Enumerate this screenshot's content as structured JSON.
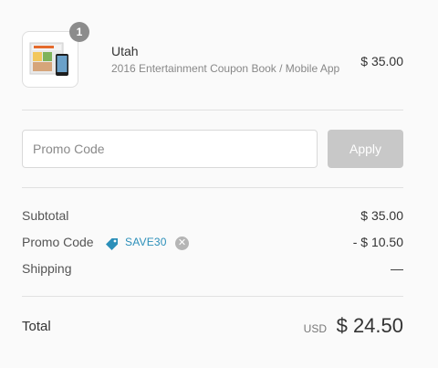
{
  "cart": {
    "item": {
      "quantity": "1",
      "name": "Utah",
      "variant": "2016 Entertainment Coupon Book / Mobile App",
      "price": "$ 35.00"
    }
  },
  "promo": {
    "placeholder": "Promo Code",
    "apply_label": "Apply"
  },
  "summary": {
    "subtotal_label": "Subtotal",
    "subtotal_value": "$ 35.00",
    "promo_label": "Promo Code",
    "promo_code": "SAVE30",
    "promo_value": "- $ 10.50",
    "shipping_label": "Shipping",
    "shipping_value": "—",
    "total_label": "Total",
    "currency": "USD",
    "total_value": "$ 24.50"
  },
  "colors": {
    "accent": "#2b8fb9",
    "button_disabled": "#c8c8c8",
    "badge": "#8c8c8c"
  }
}
